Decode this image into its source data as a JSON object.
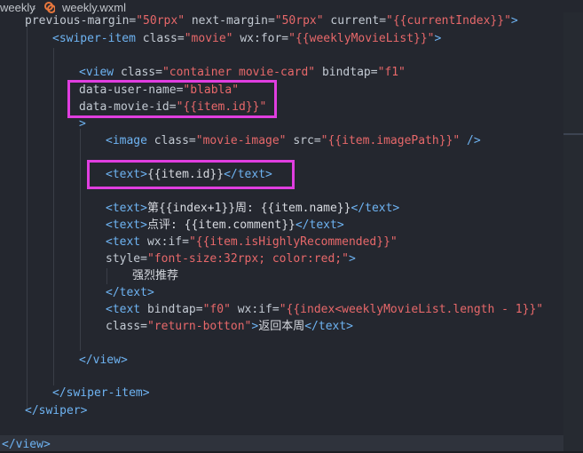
{
  "breadcrumb": {
    "folder": "weekly",
    "separator": "›",
    "file": "weekly.wxml"
  },
  "code": {
    "l1": {
      "a": "previous-margin=",
      "b": "\"50rpx\"",
      "c": " next-margin=",
      "d": "\"50rpx\"",
      "e": " current=",
      "f": "\"{{currentIndex}}\"",
      "g": ">"
    },
    "l2": {
      "a": "<swiper-item",
      "b": " class=",
      "c": "\"movie\"",
      "d": " wx:for=",
      "e": "\"{{weeklyMovieList}}\"",
      "f": ">"
    },
    "l3": {
      "a": "<view",
      "b": " class=",
      "c": "\"container movie-card\"",
      "d": " bindtap=",
      "e": "\"f1\""
    },
    "l4": {
      "a": "data-user-name=",
      "b": "\"blabla\""
    },
    "l5": {
      "a": "data-movie-id=",
      "b": "\"{{item.id}}\""
    },
    "l6": {
      "a": ">"
    },
    "l7": {
      "a": "<image",
      "b": " class=",
      "c": "\"movie-image\"",
      "d": " src=",
      "e": "\"{{item.imagePath}}\"",
      "f": " />"
    },
    "l8": {
      "a": "<text>",
      "b": "{{item.id}}",
      "c": "</text>"
    },
    "l9": {
      "a": "<text>",
      "b": "第{{index+1}}周: {{item.name}}",
      "c": "</text>"
    },
    "l10": {
      "a": "<text>",
      "b": "点评: {{item.comment}}",
      "c": "</text>"
    },
    "l11": {
      "a": "<text",
      "b": " wx:if=",
      "c": "\"{{item.isHighlyRecommended}}\""
    },
    "l12": {
      "a": "style=",
      "b": "\"font-size:32rpx; color:red;\"",
      "c": ">"
    },
    "l13": {
      "a": "强烈推荐"
    },
    "l14": {
      "a": "</text>"
    },
    "l15": {
      "a": "<text",
      "b": " bindtap=",
      "c": "\"f0\"",
      "d": " wx:if=",
      "e": "\"{{index<weeklyMovieList.length - 1}}\""
    },
    "l16": {
      "a": "class=",
      "b": "\"return-botton\"",
      "c": ">",
      "d": "返回本周",
      "e": "</text>"
    },
    "l17": {
      "a": "</view>"
    },
    "l18": {
      "a": "</swiper-item>"
    },
    "l19": {
      "a": "</swiper>"
    },
    "l20": {
      "a": "</view>"
    }
  },
  "colors": {
    "tag": "#6eb3f2",
    "attribute": "#c3cad3",
    "string": "#e7686a",
    "text": "#d7dae0",
    "highlight": "#e03ee0"
  }
}
